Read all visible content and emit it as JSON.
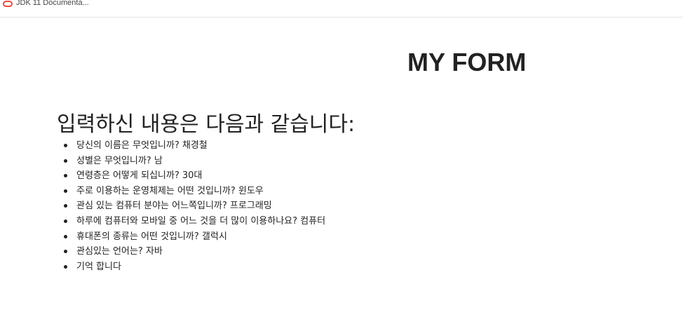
{
  "bookmarks_bar": {
    "items": [
      {
        "label": "JDK 11 Documenta...",
        "icon": "oracle-logo-icon",
        "icon_color": "#e74c3c"
      }
    ]
  },
  "page": {
    "title": "MY FORM",
    "result_heading": "입력하신 내용은 다음과 같습니다:",
    "results": [
      "당신의 이름은 무엇입니까? 채경철",
      "성별은 무엇입니까? 남",
      "연령층은 어떻게 되십니까? 30대",
      "주로 이용하는 운영체제는 어떤 것입니까? 윈도우",
      "관심 있는 컴퓨터 분야는 어느쪽입니까? 프로그래밍",
      "하루에 컴퓨터와 모바일 중 어느 것을 더 많이 이용하나요? 컴퓨터",
      "휴대폰의 종류는 어떤 것입니까? 갤럭시",
      "관심있는 언어는? 자바",
      "기억 합니다"
    ]
  }
}
